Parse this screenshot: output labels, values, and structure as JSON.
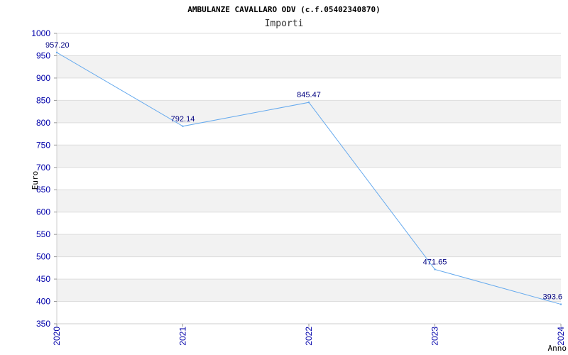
{
  "chart_data": {
    "type": "line",
    "title": "AMBULANZE CAVALLARO ODV (c.f.05402340870)",
    "subtitle": "Importi",
    "xlabel": "Anno",
    "ylabel": "Euro",
    "categories": [
      "2020",
      "2021",
      "2022",
      "2023",
      "2024"
    ],
    "series": [
      {
        "values": [
          957.2,
          792.14,
          845.47,
          471.65,
          393.6
        ],
        "labels": [
          "957.20",
          "792.14",
          "845.47",
          "471.65",
          "393.6"
        ]
      }
    ],
    "ylim": [
      350,
      1000
    ],
    "yticks": [
      "350",
      "400",
      "450",
      "500",
      "550",
      "600",
      "650",
      "700",
      "750",
      "800",
      "850",
      "900",
      "950",
      "1000"
    ],
    "grid": true,
    "colors": {
      "line": "#66aaee",
      "band": "#f2f2f2",
      "grid": "#dddddd",
      "axis": "#cccccc",
      "tick_text": "#0000aa",
      "data_label": "#000080"
    }
  }
}
